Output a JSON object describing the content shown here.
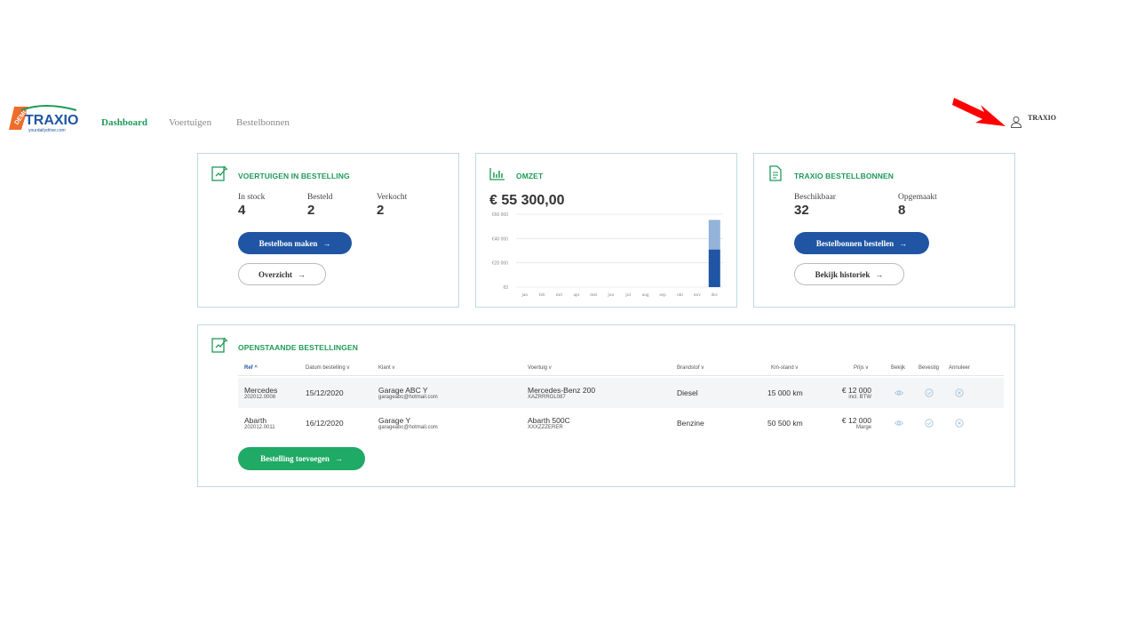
{
  "header": {
    "logo_badge": "DEMO",
    "logo_text": "TRAXIO",
    "logo_tagline": "yourdailydrive.com",
    "nav": [
      {
        "label": "Dashboard",
        "active": true
      },
      {
        "label": "Voertuigen",
        "active": false
      },
      {
        "label": "Bestelbonnen",
        "active": false
      }
    ],
    "user_icon": "user-icon",
    "user_name": "TRAXIO"
  },
  "card_vehicles": {
    "icon": "document-edit-icon",
    "title": "VOERTUIGEN IN BESTELLING",
    "stats": [
      {
        "label": "In stock",
        "value": "4"
      },
      {
        "label": "Besteld",
        "value": "2"
      },
      {
        "label": "Verkocht",
        "value": "2"
      }
    ],
    "primary_button": "Bestelbon maken",
    "secondary_button": "Overzicht"
  },
  "card_revenue": {
    "icon": "bar-chart-icon",
    "title": "OMZET",
    "total": "€ 55 300,00"
  },
  "card_orders": {
    "icon": "document-icon",
    "title": "TRAXIO BESTELLBONNEN",
    "stats": [
      {
        "label": "Beschikbaar",
        "value": "32"
      },
      {
        "label": "Opgemaakt",
        "value": "8"
      }
    ],
    "primary_button": "Bestelbonnen bestellen",
    "secondary_button": "Bekijk historiek"
  },
  "chart_data": {
    "type": "bar",
    "categories": [
      "jan",
      "feb",
      "mrt",
      "apr",
      "mei",
      "jun",
      "jul",
      "aug",
      "sep",
      "okt",
      "nov",
      "dec"
    ],
    "series": [
      {
        "values": [
          0,
          0,
          0,
          0,
          0,
          0,
          0,
          0,
          0,
          0,
          0,
          31000
        ],
        "color": "#1f55a3"
      },
      {
        "values": [
          0,
          0,
          0,
          0,
          0,
          0,
          0,
          0,
          0,
          0,
          0,
          24300
        ],
        "color": "#93b3d8"
      }
    ],
    "stacked": true,
    "yticks": [
      "€0",
      "€20 000",
      "€40 000",
      "€60 000"
    ],
    "ylim": [
      0,
      60000
    ],
    "grid": true
  },
  "open_orders": {
    "icon": "document-edit-icon",
    "title": "OPENSTAANDE BESTELLINGEN",
    "columns": [
      "Ref",
      "Datum bestelling",
      "Klant",
      "Voertuig",
      "Brandstof",
      "Km-stand",
      "Prijs",
      "Bekijk",
      "Bevestig",
      "Annuleer"
    ],
    "sort_indicators": [
      "^",
      "v",
      "v",
      "v",
      "v",
      "v",
      "v"
    ],
    "rows": [
      {
        "ref": "Mercedes",
        "ref_sub": "202012.0008",
        "date": "15/12/2020",
        "client": "Garage ABC Y",
        "client_sub": "garageabc@hotmail.com",
        "vehicle": "Mercedes-Benz 200",
        "vehicle_sub": "XAZRRRGL087",
        "fuel": "Diesel",
        "km": "15 000 km",
        "price": "€ 12 000",
        "price_sub": "incl. BTW"
      },
      {
        "ref": "Abarth",
        "ref_sub": "202012.0011",
        "date": "16/12/2020",
        "client": "Garage Y",
        "client_sub": "garageabc@hotmail.com",
        "vehicle": "Abarth 500C",
        "vehicle_sub": "XXXZZZERER",
        "fuel": "Benzine",
        "km": "50 500 km",
        "price": "€ 12 000",
        "price_sub": "Marge"
      }
    ],
    "row_action_icons": [
      "eye-icon",
      "check-circle-icon",
      "x-circle-icon"
    ],
    "add_button": "Bestelling toevoegen"
  },
  "colors": {
    "green": "#1f9a57",
    "blue": "#1f55a3",
    "light_blue": "#93b3d8",
    "card_border": "#bfd9e6",
    "annotation_red": "#ff0000"
  }
}
